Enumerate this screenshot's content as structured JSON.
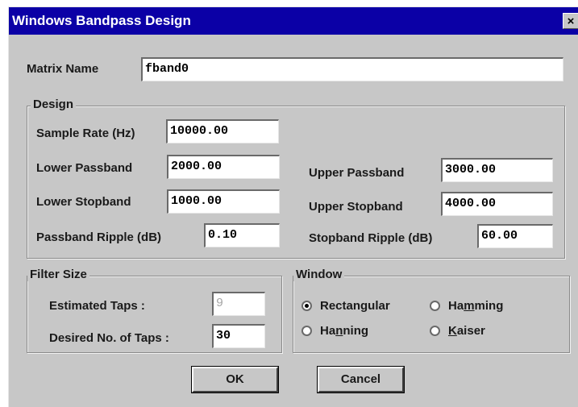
{
  "window": {
    "title": "Windows Bandpass Design",
    "close_glyph": "×"
  },
  "matrix": {
    "label": "Matrix Name",
    "value": "fband0"
  },
  "design": {
    "title": "Design",
    "sample_rate_label": "Sample Rate (Hz)",
    "sample_rate_value": "10000.00",
    "lower_passband_label": "Lower Passband",
    "lower_passband_value": "2000.00",
    "upper_passband_label": "Upper Passband",
    "upper_passband_value": "3000.00",
    "lower_stopband_label": "Lower Stopband",
    "lower_stopband_value": "1000.00",
    "upper_stopband_label": "Upper Stopband",
    "upper_stopband_value": "4000.00",
    "passband_ripple_label": "Passband Ripple (dB)",
    "passband_ripple_value": "0.10",
    "stopband_ripple_label": "Stopband Ripple (dB)",
    "stopband_ripple_value": "60.00"
  },
  "filter_size": {
    "title": "Filter Size",
    "estimated_taps_label": "Estimated Taps :",
    "estimated_taps_value": "9",
    "desired_taps_label": "Desired No. of Taps :",
    "desired_taps_value": "30"
  },
  "window_type": {
    "title": "Window",
    "options": {
      "rectangular": {
        "label": "Rectangular",
        "checked": true
      },
      "hamming": {
        "label_pre": "Ha",
        "label_ul": "m",
        "label_post": "ming",
        "checked": false
      },
      "hanning": {
        "label_pre": "Ha",
        "label_ul": "n",
        "label_post": "ning",
        "checked": false
      },
      "kaiser": {
        "label_pre": "",
        "label_ul": "K",
        "label_post": "aiser",
        "checked": false
      }
    }
  },
  "buttons": {
    "ok": "OK",
    "cancel": "Cancel"
  },
  "colors": {
    "titlebar": "#0b00a6",
    "dialog_face": "#c7c7c7"
  }
}
